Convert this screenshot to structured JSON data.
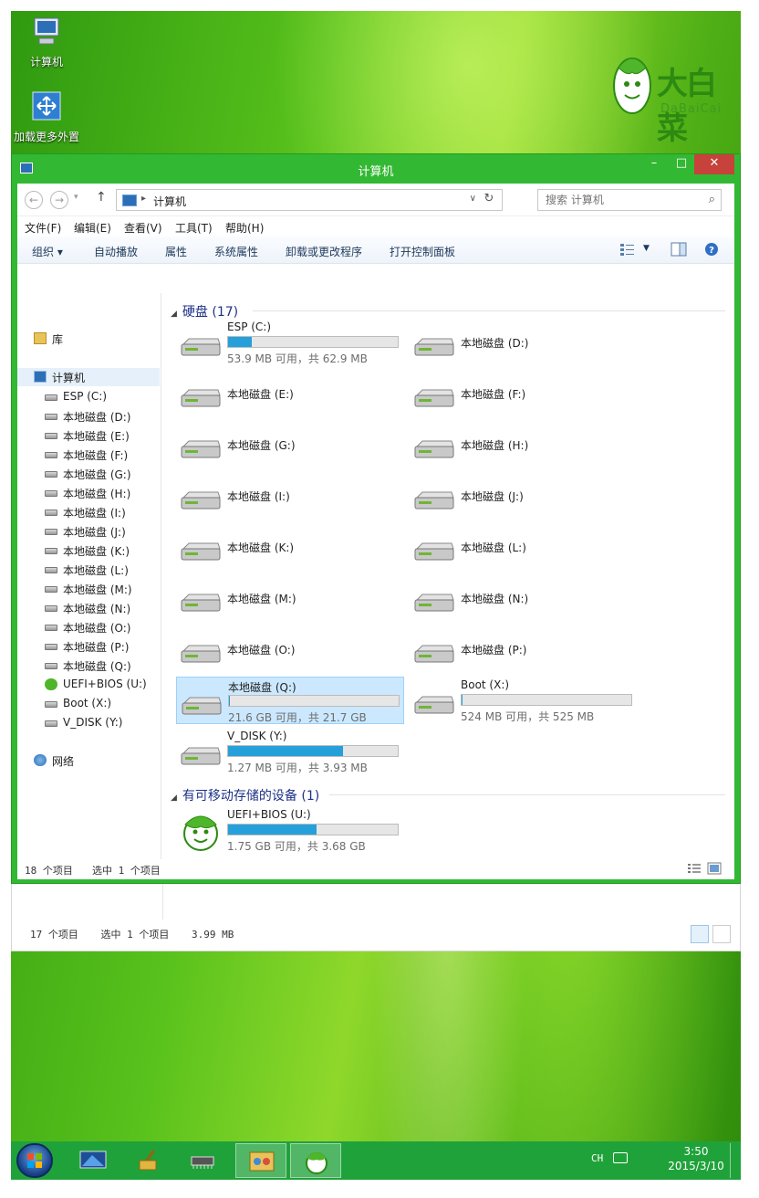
{
  "desktop": {
    "icons": [
      {
        "label": "计算机"
      },
      {
        "label": "加载更多外置"
      }
    ],
    "brand": {
      "name_cn": "大白菜",
      "name_en": "DaBaiCai"
    }
  },
  "window": {
    "title": "计算机",
    "buttons": {
      "minimize": "–",
      "maximize": "□",
      "close": "✕"
    },
    "address": {
      "crumb": "计算机",
      "separator": "▸"
    },
    "search": {
      "placeholder": "搜索 计算机"
    },
    "menu": [
      "文件(F)",
      "编辑(E)",
      "查看(V)",
      "工具(T)",
      "帮助(H)"
    ],
    "commands": [
      "组织 ▾",
      "自动播放",
      "属性",
      "系统属性",
      "卸载或更改程序",
      "打开控制面板"
    ],
    "nav": {
      "library": "库",
      "computer": "计算机",
      "drives": [
        "ESP (C:)",
        "本地磁盘 (D:)",
        "本地磁盘 (E:)",
        "本地磁盘 (F:)",
        "本地磁盘 (G:)",
        "本地磁盘 (H:)",
        "本地磁盘 (I:)",
        "本地磁盘 (J:)",
        "本地磁盘 (K:)",
        "本地磁盘 (L:)",
        "本地磁盘 (M:)",
        "本地磁盘 (N:)",
        "本地磁盘 (O:)",
        "本地磁盘 (P:)",
        "本地磁盘 (Q:)",
        "UEFI+BIOS (U:)",
        "Boot (X:)",
        "V_DISK (Y:)"
      ],
      "network": "网络"
    },
    "groups": {
      "hdd": "硬盘 (17)",
      "removable": "有可移动存储的设备 (1)"
    },
    "tiles": [
      {
        "name": "ESP (C:)",
        "caption": "53.9 MB 可用，共 62.9 MB",
        "used": 0.14
      },
      {
        "name": "本地磁盘 (D:)"
      },
      {
        "name": "本地磁盘 (E:)"
      },
      {
        "name": "本地磁盘 (F:)"
      },
      {
        "name": "本地磁盘 (G:)"
      },
      {
        "name": "本地磁盘 (H:)"
      },
      {
        "name": "本地磁盘 (I:)"
      },
      {
        "name": "本地磁盘 (J:)"
      },
      {
        "name": "本地磁盘 (K:)"
      },
      {
        "name": "本地磁盘 (L:)"
      },
      {
        "name": "本地磁盘 (M:)"
      },
      {
        "name": "本地磁盘 (N:)"
      },
      {
        "name": "本地磁盘 (O:)"
      },
      {
        "name": "本地磁盘 (P:)"
      },
      {
        "name": "本地磁盘 (Q:)",
        "caption": "21.6 GB 可用，共 21.7 GB",
        "used": 0.005,
        "selected": true
      },
      {
        "name": "Boot (X:)",
        "caption": "524 MB 可用，共 525 MB",
        "used": 0.002
      },
      {
        "name": "V_DISK (Y:)",
        "caption": "1.27 MB 可用，共 3.93 MB",
        "used": 0.68
      }
    ],
    "removable": {
      "name": "UEFI+BIOS (U:)",
      "caption": "1.75 GB 可用，共 3.68 GB",
      "used": 0.52
    },
    "status": {
      "count": "18 个项目",
      "selected": "选中 1 个项目"
    }
  },
  "back_window": {
    "count": "17 个项目",
    "selected": "选中 1 个项目",
    "size": "3.99 MB"
  },
  "taskbar": {
    "lang": "CH",
    "time": "3:50",
    "date": "2015/3/10"
  },
  "colors": {
    "window_frame": "#33b833",
    "taskbar": "#20a23a",
    "progress": "#26a0da",
    "selection": "#cce8ff"
  }
}
